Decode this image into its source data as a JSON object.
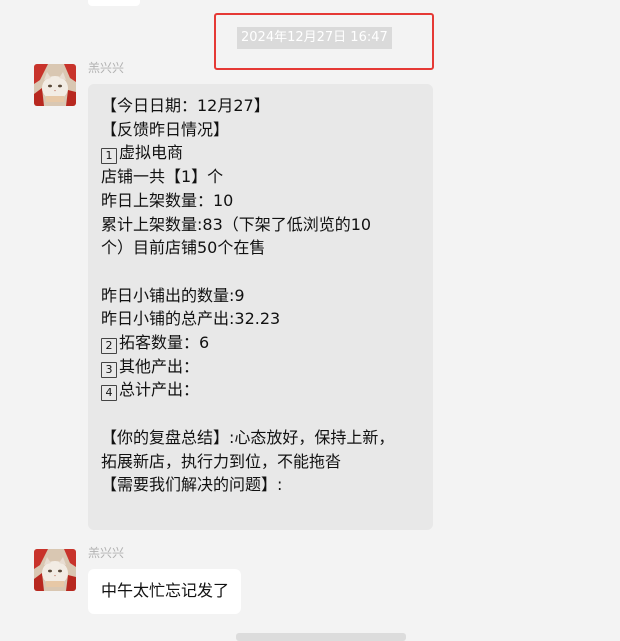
{
  "timestamp": "2024年12月27日 16:47",
  "messages": [
    {
      "sender": "羔兴兴",
      "lines": [
        {
          "text": "【今日日期：12月27】"
        },
        {
          "text": "【反馈昨日情况】"
        },
        {
          "badge": "1",
          "text": "虚拟电商"
        },
        {
          "text": "店铺一共【1】个"
        },
        {
          "text": "昨日上架数量：10"
        },
        {
          "text": "累计上架数量:83（下架了低浏览的10"
        },
        {
          "text": "个）目前店铺50个在售"
        },
        {
          "text": ""
        },
        {
          "text": "昨日小铺出的数量:9"
        },
        {
          "text": "昨日小铺的总产出:32.23"
        },
        {
          "badge": "2",
          "text": "拓客数量：6"
        },
        {
          "badge": "3",
          "text": "其他产出："
        },
        {
          "badge": "4",
          "text": "总计产出："
        },
        {
          "text": ""
        },
        {
          "text": "【你的复盘总结】:心态放好，保持上新，"
        },
        {
          "text": "拓展新店，执行力到位，不能拖沓"
        },
        {
          "text": "【需要我们解决的问题】:"
        }
      ]
    },
    {
      "sender": "羔兴兴",
      "lines": [
        {
          "text": "中午太忙忘记发了"
        }
      ]
    }
  ],
  "colors": {
    "background": "#f3f3f3",
    "incoming_bubble": "#e8e8e8",
    "white_bubble": "#ffffff",
    "highlight_box": "#e53935"
  }
}
